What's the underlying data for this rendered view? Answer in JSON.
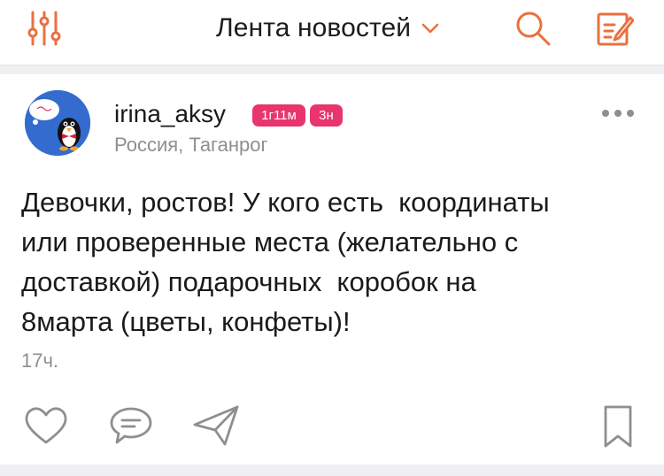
{
  "header": {
    "title": "Лента новостей"
  },
  "post": {
    "author": "irina_aksy",
    "badges": [
      "1г11м",
      "3н"
    ],
    "location": "Россия, Таганрог",
    "text": "Девочки, ростов! У кого есть  координаты\nили проверенные места (желательно с\nдоставкой) подарочных  коробок на\n8марта (цветы, конфеты)!",
    "time": "17ч."
  },
  "colors": {
    "accent": "#e8713f",
    "badge": "#e8356d",
    "secondary_text": "#8e8e93",
    "icon_gray": "#8e8e93"
  },
  "icons": {
    "header": [
      "sliders-icon",
      "chevron-down-icon",
      "search-icon",
      "compose-icon"
    ],
    "actions": [
      "heart-icon",
      "comment-icon",
      "share-icon",
      "bookmark-icon"
    ]
  }
}
